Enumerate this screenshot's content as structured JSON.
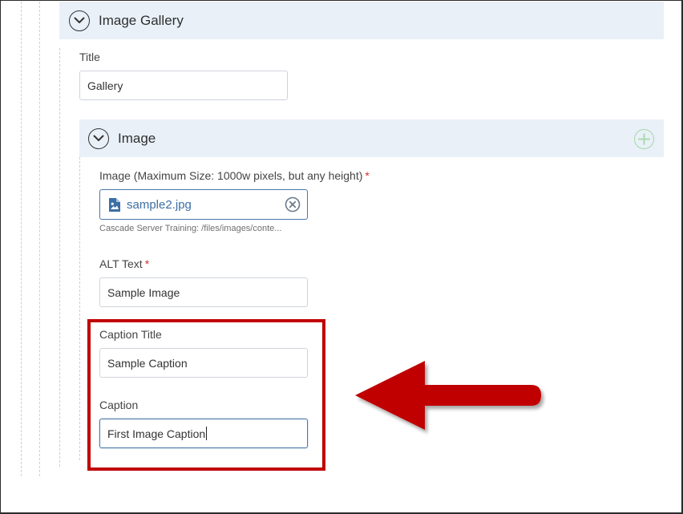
{
  "gallery": {
    "header_title": "Image Gallery",
    "title_label": "Title",
    "title_value": "Gallery"
  },
  "image_section": {
    "header_title": "Image",
    "image_label": "Image (Maximum Size: 1000w pixels, but any height)",
    "required_mark": "*",
    "file_name": "sample2.jpg",
    "file_path": "Cascade Server Training: /files/images/conte...",
    "alt_label": "ALT Text",
    "alt_value": "Sample Image",
    "caption_title_label": "Caption Title",
    "caption_title_value": "Sample Caption",
    "caption_label": "Caption",
    "caption_value": "First Image Caption"
  },
  "colors": {
    "annotation": "#c00000",
    "header_bg": "#e9f0f8",
    "link_blue": "#3c6fa3",
    "required": "#d32f2f",
    "add_green": "#a6d8a6"
  },
  "icons": [
    "chevron-down-icon",
    "image-file-icon",
    "clear-icon",
    "add-icon",
    "arrow-annotation"
  ]
}
